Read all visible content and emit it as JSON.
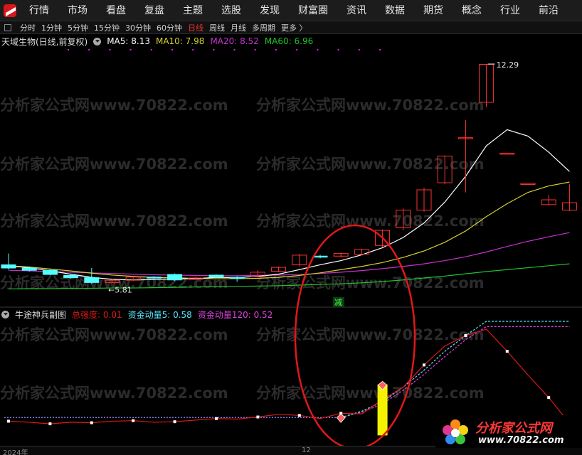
{
  "nav": {
    "items": [
      "行情",
      "市场",
      "看盘",
      "复盘",
      "主题",
      "选股",
      "发现",
      "财富圈",
      "资讯",
      "数据",
      "期货",
      "概念",
      "行业",
      "前沿"
    ]
  },
  "periods": {
    "items": [
      "分时",
      "1分钟",
      "5分钟",
      "15分钟",
      "30分钟",
      "60分钟",
      "日线",
      "周线",
      "月线",
      "多周期",
      "更多 〉"
    ],
    "active": "日线"
  },
  "stock": {
    "name": "天域生物(日线,前复权)",
    "ma5_label": "MA5: 8.13",
    "ma10_label": "MA10: 7.98",
    "ma20_label": "MA20: 8.52",
    "ma60_label": "MA60: 6.96",
    "high_label": "12.29",
    "low_label": "←5.81"
  },
  "indicator": {
    "name": "牛途神兵副图",
    "total_label": "总强度: 0.01",
    "flow5_label": "资金动量5: 0.58",
    "flow120_label": "资金动量120: 0.52",
    "reduce_label": "减"
  },
  "axis": {
    "year": "2024年",
    "month": "12"
  },
  "watermark": "分析家公式网www.70822.com",
  "brand": {
    "name": "分析家公式网",
    "url": "www.70822.com"
  },
  "colors": {
    "up": "#ff3232",
    "down": "#54ffff",
    "ma5": "#ffffff",
    "ma10": "#d4d030",
    "ma20": "#c832d0",
    "ma60": "#1fc32a",
    "total": "#e01818",
    "flow": "#54e8ff",
    "flow120": "#e040e0"
  },
  "chart_data": {
    "type": "candlestick",
    "candles": [
      {
        "o": 6.05,
        "c": 5.95,
        "h": 6.4,
        "l": 5.9
      },
      {
        "o": 5.95,
        "c": 5.88,
        "h": 6.0,
        "l": 5.84
      },
      {
        "o": 5.88,
        "c": 5.75,
        "h": 5.92,
        "l": 5.72
      },
      {
        "o": 5.72,
        "c": 5.65,
        "h": 5.75,
        "l": 5.62
      },
      {
        "o": 5.65,
        "c": 5.5,
        "h": 5.95,
        "l": 5.45
      },
      {
        "o": 5.5,
        "c": 5.57,
        "h": 5.62,
        "l": 5.48
      },
      {
        "o": 5.57,
        "c": 5.67,
        "h": 5.7,
        "l": 5.55
      },
      {
        "o": 5.67,
        "c": 5.65,
        "h": 5.7,
        "l": 5.62
      },
      {
        "o": 5.75,
        "c": 5.58,
        "h": 5.78,
        "l": 5.55
      },
      {
        "o": 5.6,
        "c": 5.64,
        "h": 5.68,
        "l": 5.58
      },
      {
        "o": 5.73,
        "c": 5.67,
        "h": 5.75,
        "l": 5.65
      },
      {
        "o": 5.66,
        "c": 5.64,
        "h": 5.7,
        "l": 5.52
      },
      {
        "o": 5.68,
        "c": 5.82,
        "h": 5.88,
        "l": 5.65
      },
      {
        "o": 5.85,
        "c": 5.97,
        "h": 6.0,
        "l": 5.82
      },
      {
        "o": 6.05,
        "c": 6.35,
        "h": 6.38,
        "l": 6.0
      },
      {
        "o": 6.32,
        "c": 6.3,
        "h": 6.36,
        "l": 6.25
      },
      {
        "o": 6.32,
        "c": 6.4,
        "h": 6.44,
        "l": 6.28
      },
      {
        "o": 6.38,
        "c": 6.52,
        "h": 6.55,
        "l": 6.35
      },
      {
        "o": 6.65,
        "c": 7.12,
        "h": 7.15,
        "l": 6.6
      },
      {
        "o": 7.2,
        "c": 7.75,
        "h": 7.8,
        "l": 7.12
      },
      {
        "o": 7.75,
        "c": 8.38,
        "h": 8.45,
        "l": 7.7
      },
      {
        "o": 8.6,
        "c": 9.43,
        "h": 9.45,
        "l": 8.55
      },
      {
        "o": 10.0,
        "c": 10.0,
        "h": 10.55,
        "l": 8.3
      },
      {
        "o": 11.1,
        "c": 12.28,
        "h": 12.29,
        "l": 10.95
      },
      {
        "o": 9.52,
        "c": 9.52,
        "h": 9.52,
        "l": 9.52
      },
      {
        "o": 8.58,
        "c": 8.58,
        "h": 8.58,
        "l": 8.58
      },
      {
        "o": 7.92,
        "c": 8.07,
        "h": 8.22,
        "l": 7.9
      },
      {
        "o": 7.75,
        "c": 7.98,
        "h": 8.55,
        "l": 7.72
      }
    ],
    "ma5": [
      6.02,
      5.96,
      5.86,
      5.76,
      5.66,
      5.6,
      5.58,
      5.59,
      5.61,
      5.62,
      5.66,
      5.65,
      5.69,
      5.76,
      5.9,
      6.05,
      6.18,
      6.36,
      6.58,
      6.9,
      7.35,
      8.0,
      8.8,
      9.75,
      10.25,
      10.05,
      9.55,
      8.95
    ],
    "ma10": [
      6.02,
      5.98,
      5.92,
      5.86,
      5.79,
      5.73,
      5.69,
      5.66,
      5.64,
      5.63,
      5.62,
      5.62,
      5.63,
      5.66,
      5.72,
      5.8,
      5.9,
      6.0,
      6.12,
      6.28,
      6.48,
      6.75,
      7.1,
      7.55,
      7.95,
      8.3,
      8.5,
      8.62
    ],
    "ma20": [
      5.88,
      5.86,
      5.84,
      5.82,
      5.8,
      5.78,
      5.76,
      5.74,
      5.73,
      5.72,
      5.71,
      5.71,
      5.72,
      5.73,
      5.75,
      5.78,
      5.82,
      5.87,
      5.93,
      6.0,
      6.08,
      6.18,
      6.3,
      6.45,
      6.62,
      6.78,
      6.92,
      7.05
    ],
    "ma60": [
      5.3,
      5.31,
      5.31,
      5.32,
      5.32,
      5.33,
      5.33,
      5.34,
      5.35,
      5.36,
      5.37,
      5.38,
      5.39,
      5.4,
      5.42,
      5.44,
      5.46,
      5.49,
      5.53,
      5.58,
      5.64,
      5.7,
      5.77,
      5.84,
      5.9,
      5.96,
      6.02,
      6.08
    ],
    "total_strength": [
      0.05,
      0.03,
      0.0,
      0.03,
      0.02,
      0.05,
      0.06,
      0.03,
      0.04,
      0.07,
      0.1,
      0.09,
      0.13,
      0.18,
      0.16,
      0.1,
      0.2,
      0.19,
      0.46,
      0.7,
      1.12,
      1.48,
      1.68,
      1.8,
      1.38,
      0.93,
      0.5,
      0.01
    ],
    "flow5": [
      null,
      null,
      null,
      null,
      null,
      null,
      null,
      null,
      null,
      null,
      null,
      null,
      null,
      null,
      null,
      null,
      0.12,
      0.24,
      0.42,
      0.7,
      1.02,
      1.38,
      1.68,
      1.95,
      1.95,
      1.95,
      1.95,
      1.95
    ],
    "flow120": [
      null,
      null,
      null,
      null,
      null,
      null,
      null,
      null,
      null,
      null,
      null,
      null,
      null,
      null,
      null,
      null,
      0.12,
      0.22,
      0.38,
      0.64,
      0.94,
      1.28,
      1.6,
      1.85,
      1.85,
      1.85,
      1.85,
      1.85
    ],
    "baseline": 0.12
  }
}
